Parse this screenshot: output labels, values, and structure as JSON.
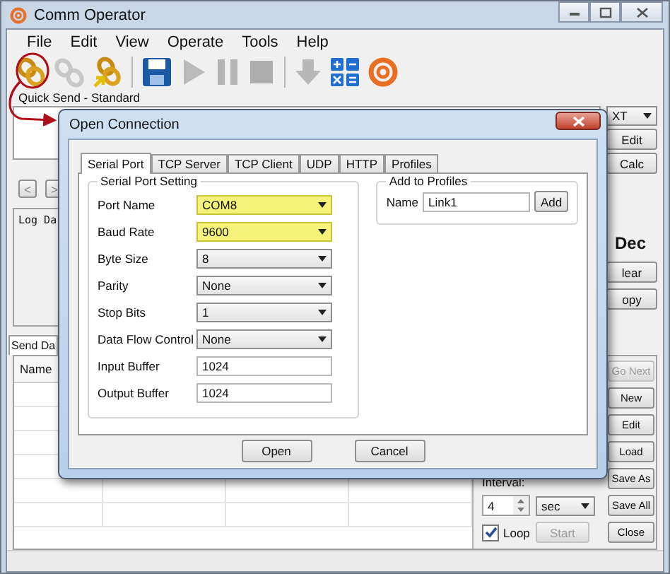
{
  "window": {
    "title": "Comm Operator"
  },
  "menu": [
    "File",
    "Edit",
    "View",
    "Operate",
    "Tools",
    "Help"
  ],
  "toolbar": [
    {
      "kind": "connect",
      "disabled": false
    },
    {
      "kind": "disconnect",
      "disabled": true
    },
    {
      "kind": "connect-profile",
      "disabled": false
    },
    {
      "kind": "separator"
    },
    {
      "kind": "save",
      "disabled": false
    },
    {
      "kind": "play",
      "disabled": true
    },
    {
      "kind": "pause",
      "disabled": true
    },
    {
      "kind": "stop",
      "disabled": true
    },
    {
      "kind": "separator"
    },
    {
      "kind": "down",
      "disabled": true
    },
    {
      "kind": "calculator",
      "disabled": false
    },
    {
      "kind": "logo",
      "disabled": false
    }
  ],
  "quick_send": {
    "label": "Quick Send - Standard",
    "format": "XT",
    "buttons": [
      "Edit",
      "Calc"
    ],
    "nav": [
      "<",
      ">"
    ]
  },
  "log": {
    "label": "Log Da",
    "format": "Dec",
    "buttons": [
      "lear",
      "opy"
    ]
  },
  "send": {
    "tab": "Send Da",
    "column": "Name",
    "interval_label": "Interval:",
    "interval": "4",
    "unit": "sec",
    "loop": {
      "label": "Loop",
      "checked": true
    },
    "start": {
      "label": "Start",
      "disabled": true
    },
    "buttons": [
      {
        "label": "Go Next",
        "disabled": true
      },
      {
        "label": "New",
        "disabled": false
      },
      {
        "label": "Edit",
        "disabled": false
      },
      {
        "label": "Load",
        "disabled": false
      },
      {
        "label": "Save As",
        "disabled": false
      },
      {
        "label": "Save All",
        "disabled": false
      },
      {
        "label": "Close",
        "disabled": false
      }
    ]
  },
  "dialog": {
    "title": "Open Connection",
    "tabs": [
      {
        "label": "Serial Port",
        "selected": true
      },
      {
        "label": "TCP Server",
        "selected": false
      },
      {
        "label": "TCP Client",
        "selected": false
      },
      {
        "label": "UDP",
        "selected": false
      },
      {
        "label": "HTTP",
        "selected": false
      },
      {
        "label": "Profiles",
        "selected": false
      }
    ],
    "group": "Serial Port Setting",
    "fields": [
      {
        "label": "Port Name",
        "value": "COM8",
        "kind": "select",
        "highlighted": true
      },
      {
        "label": "Baud Rate",
        "value": "9600",
        "kind": "select",
        "highlighted": true
      },
      {
        "label": "Byte Size",
        "value": "8",
        "kind": "select",
        "highlighted": false
      },
      {
        "label": "Parity",
        "value": "None",
        "kind": "select",
        "highlighted": false
      },
      {
        "label": "Stop Bits",
        "value": "1",
        "kind": "select",
        "highlighted": false
      },
      {
        "label": "Data Flow Control",
        "value": "None",
        "kind": "select",
        "highlighted": false
      },
      {
        "label": "Input Buffer",
        "value": "1024",
        "kind": "text",
        "highlighted": false
      },
      {
        "label": "Output Buffer",
        "value": "1024",
        "kind": "text",
        "highlighted": false
      }
    ],
    "profiles": {
      "title": "Add to Profiles",
      "label": "Name",
      "value": "Link1",
      "button": "Add"
    },
    "buttons": [
      "Open",
      "Cancel"
    ]
  }
}
